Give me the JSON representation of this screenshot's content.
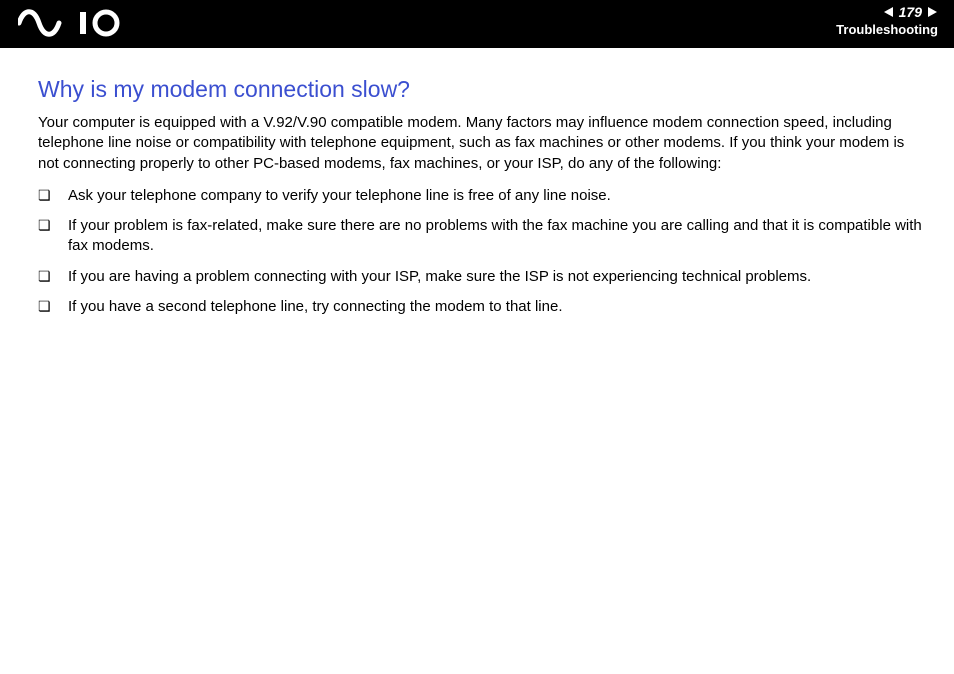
{
  "header": {
    "page_number": "179",
    "section": "Troubleshooting"
  },
  "article": {
    "title": "Why is my modem connection slow?",
    "intro": "Your computer is equipped with a V.92/V.90 compatible modem. Many factors may influence modem connection speed, including telephone line noise or compatibility with telephone equipment, such as fax machines or other modems. If you think your modem is not connecting properly to other PC-based modems, fax machines, or your ISP, do any of the following:",
    "items": [
      "Ask your telephone company to verify your telephone line is free of any line noise.",
      "If your problem is fax-related, make sure there are no problems with the fax machine you are calling and that it is compatible with fax modems.",
      "If you are having a problem connecting with your ISP, make sure the ISP is not experiencing technical problems.",
      "If you have a second telephone line, try connecting the modem to that line."
    ]
  }
}
